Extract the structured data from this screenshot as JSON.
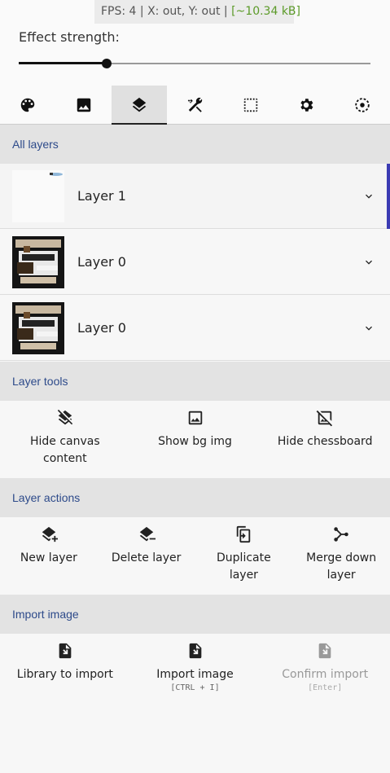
{
  "status": {
    "fps": "FPS: 4",
    "coords": "X: out, Y: out",
    "size": "[~10.34 kB]",
    "sep": "|"
  },
  "effect": {
    "label": "Effect strength:",
    "value": 0.25
  },
  "tabs": [
    {
      "icon": "palette-icon"
    },
    {
      "icon": "image-icon"
    },
    {
      "icon": "layers-icon",
      "active": true
    },
    {
      "icon": "tools-icon"
    },
    {
      "icon": "selection-icon"
    },
    {
      "icon": "settings-icon"
    },
    {
      "icon": "target-icon"
    }
  ],
  "layers_section": {
    "title": "All layers"
  },
  "layers": [
    {
      "name": "Layer 1",
      "selected": true
    },
    {
      "name": "Layer 0"
    },
    {
      "name": "Layer 0"
    }
  ],
  "layer_tools": {
    "title": "Layer tools",
    "items": [
      {
        "label": "Hide canvas content",
        "icon": "layers-clear-icon"
      },
      {
        "label": "Show bg img",
        "icon": "image-icon"
      },
      {
        "label": "Hide chessboard",
        "icon": "hide-image-icon"
      }
    ]
  },
  "layer_actions": {
    "title": "Layer actions",
    "items": [
      {
        "label": "New layer",
        "icon": "layer-add-icon"
      },
      {
        "label": "Delete layer",
        "icon": "layer-remove-icon"
      },
      {
        "label": "Duplicate layer",
        "icon": "duplicate-icon"
      },
      {
        "label": "Merge down layer",
        "icon": "merge-icon"
      }
    ]
  },
  "import": {
    "title": "Import image",
    "items": [
      {
        "label": "Library to import",
        "icon": "file-import-icon"
      },
      {
        "label": "Import image",
        "shortcut": "[CTRL + I]",
        "icon": "file-import-icon"
      },
      {
        "label": "Confirm import",
        "shortcut": "[Enter]",
        "icon": "file-import-icon",
        "disabled": true
      }
    ]
  },
  "colors": {
    "accent": "#3b3bb3",
    "section_text": "#2d4a8a",
    "fps_size": "#5b9a28"
  }
}
